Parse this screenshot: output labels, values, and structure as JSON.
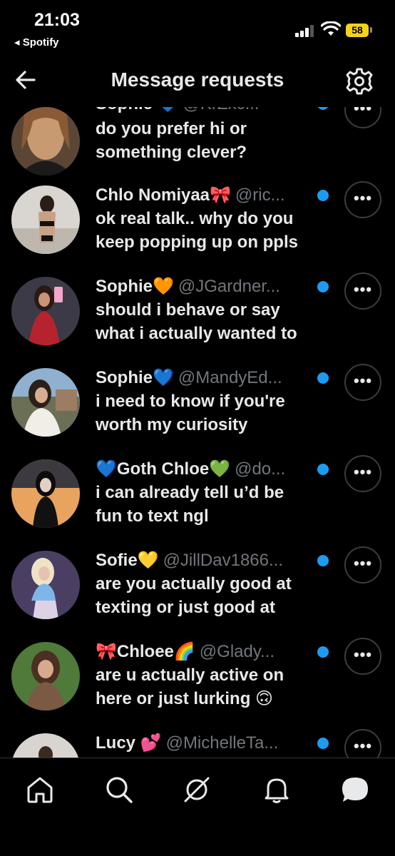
{
  "status_bar": {
    "time": "21:03",
    "back_app": "◂ Spotify",
    "battery": "58"
  },
  "header": {
    "title": "Message requests"
  },
  "colors": {
    "background": "#000000",
    "unread_dot": "#1d9bf0",
    "handle": "#71767b"
  },
  "conversations": [
    {
      "name": "Sophie 💙",
      "handle": "@KrZxc...",
      "message": "do you prefer hi or\nsomething clever?"
    },
    {
      "name": "Chlo Nomiyaa🎀",
      "handle": "@ric...",
      "message": "ok real talk.. why do you\nkeep popping up on ppls"
    },
    {
      "name": "Sophie🧡",
      "handle": "@JGardner...",
      "message": "should i behave or say\nwhat i actually wanted to"
    },
    {
      "name": "Sophie💙",
      "handle": "@MandyEd...",
      "message": "i need to know if you're\nworth my curiosity"
    },
    {
      "name": "💙Goth Chloe💚",
      "handle": "@do...",
      "message": "i can already tell u’d be\nfun to text ngl"
    },
    {
      "name": "Sofie💛",
      "handle": "@JillDav1866...",
      "message": "are you actually good at\ntexting or just good at"
    },
    {
      "name": "🎀Chloee🌈",
      "handle": "@Glady...",
      "message": "are u actually active on\nhere or just lurking 🙃"
    },
    {
      "name": "Lucy 💕",
      "handle": "@MichelleTa...",
      "message": ""
    }
  ],
  "more_label": "•••",
  "nav": [
    "home-icon",
    "search-icon",
    "grok-icon",
    "notifications-icon",
    "messages-icon"
  ]
}
